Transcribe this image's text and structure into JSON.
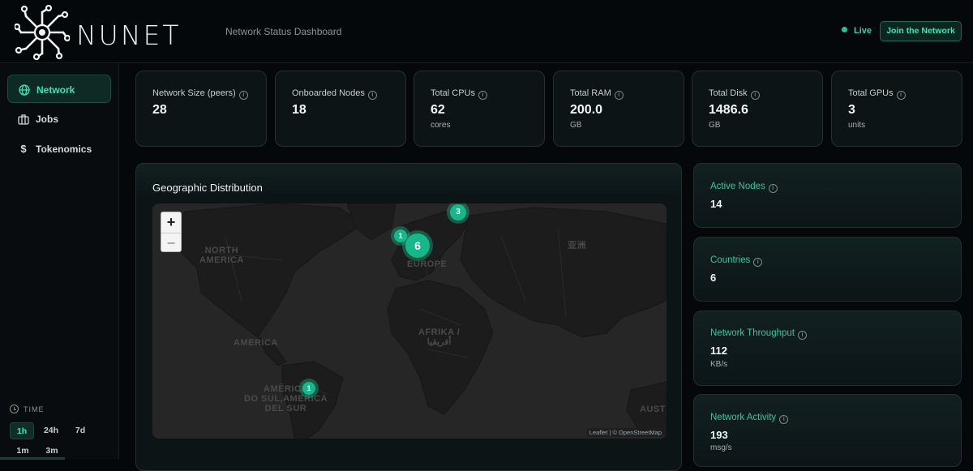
{
  "header": {
    "brand": "NUNET",
    "subtitle": "Network Status Dashboard",
    "live_label": "Live",
    "join_button": "Join the Network",
    "accent": "#2fd3a4"
  },
  "sidebar": {
    "items": [
      {
        "label": "Network",
        "icon": "globe-icon",
        "active": true
      },
      {
        "label": "Jobs",
        "icon": "briefcase-icon",
        "active": false
      },
      {
        "label": "Tokenomics",
        "icon": "dollar-icon",
        "active": false
      }
    ],
    "time_label": "TIME",
    "time_options": [
      "1h",
      "24h",
      "7d",
      "1m",
      "3m"
    ],
    "time_selected": "1h"
  },
  "stats": [
    {
      "label": "Network Size (peers)",
      "value": "28",
      "unit": ""
    },
    {
      "label": "Onboarded Nodes",
      "value": "18",
      "unit": ""
    },
    {
      "label": "Total CPUs",
      "value": "62",
      "unit": "cores"
    },
    {
      "label": "Total RAM",
      "value": "200.0",
      "unit": "GB"
    },
    {
      "label": "Total Disk",
      "value": "1486.6",
      "unit": "GB"
    },
    {
      "label": "Total GPUs",
      "value": "3",
      "unit": "units"
    }
  ],
  "map": {
    "title": "Geographic Distribution",
    "zoom_in": "+",
    "zoom_out": "−",
    "attribution": "Leaflet | © OpenStreetMap",
    "labels": {
      "north_america": "NORTH\nAMERICA",
      "america": "AMERICA",
      "south_america": "AMÉRICA\nDO SUL,AMERICA\nDEL SUR",
      "europe": "EUROPE",
      "africa": "AFRIKA /\nأفريقيا",
      "asia": "亚洲",
      "australia": "AUST"
    },
    "clusters": [
      {
        "name": "cluster-north-europe",
        "count": "3"
      },
      {
        "name": "cluster-uk",
        "count": "1"
      },
      {
        "name": "cluster-central-europe",
        "count": "6"
      },
      {
        "name": "cluster-brazil",
        "count": "1"
      }
    ]
  },
  "metrics": [
    {
      "label": "Active Nodes",
      "value": "14",
      "unit": ""
    },
    {
      "label": "Countries",
      "value": "6",
      "unit": ""
    },
    {
      "label": "Network Throughput",
      "value": "112",
      "unit": "KB/s"
    },
    {
      "label": "Network Activity",
      "value": "193",
      "unit": "msg/s"
    }
  ]
}
